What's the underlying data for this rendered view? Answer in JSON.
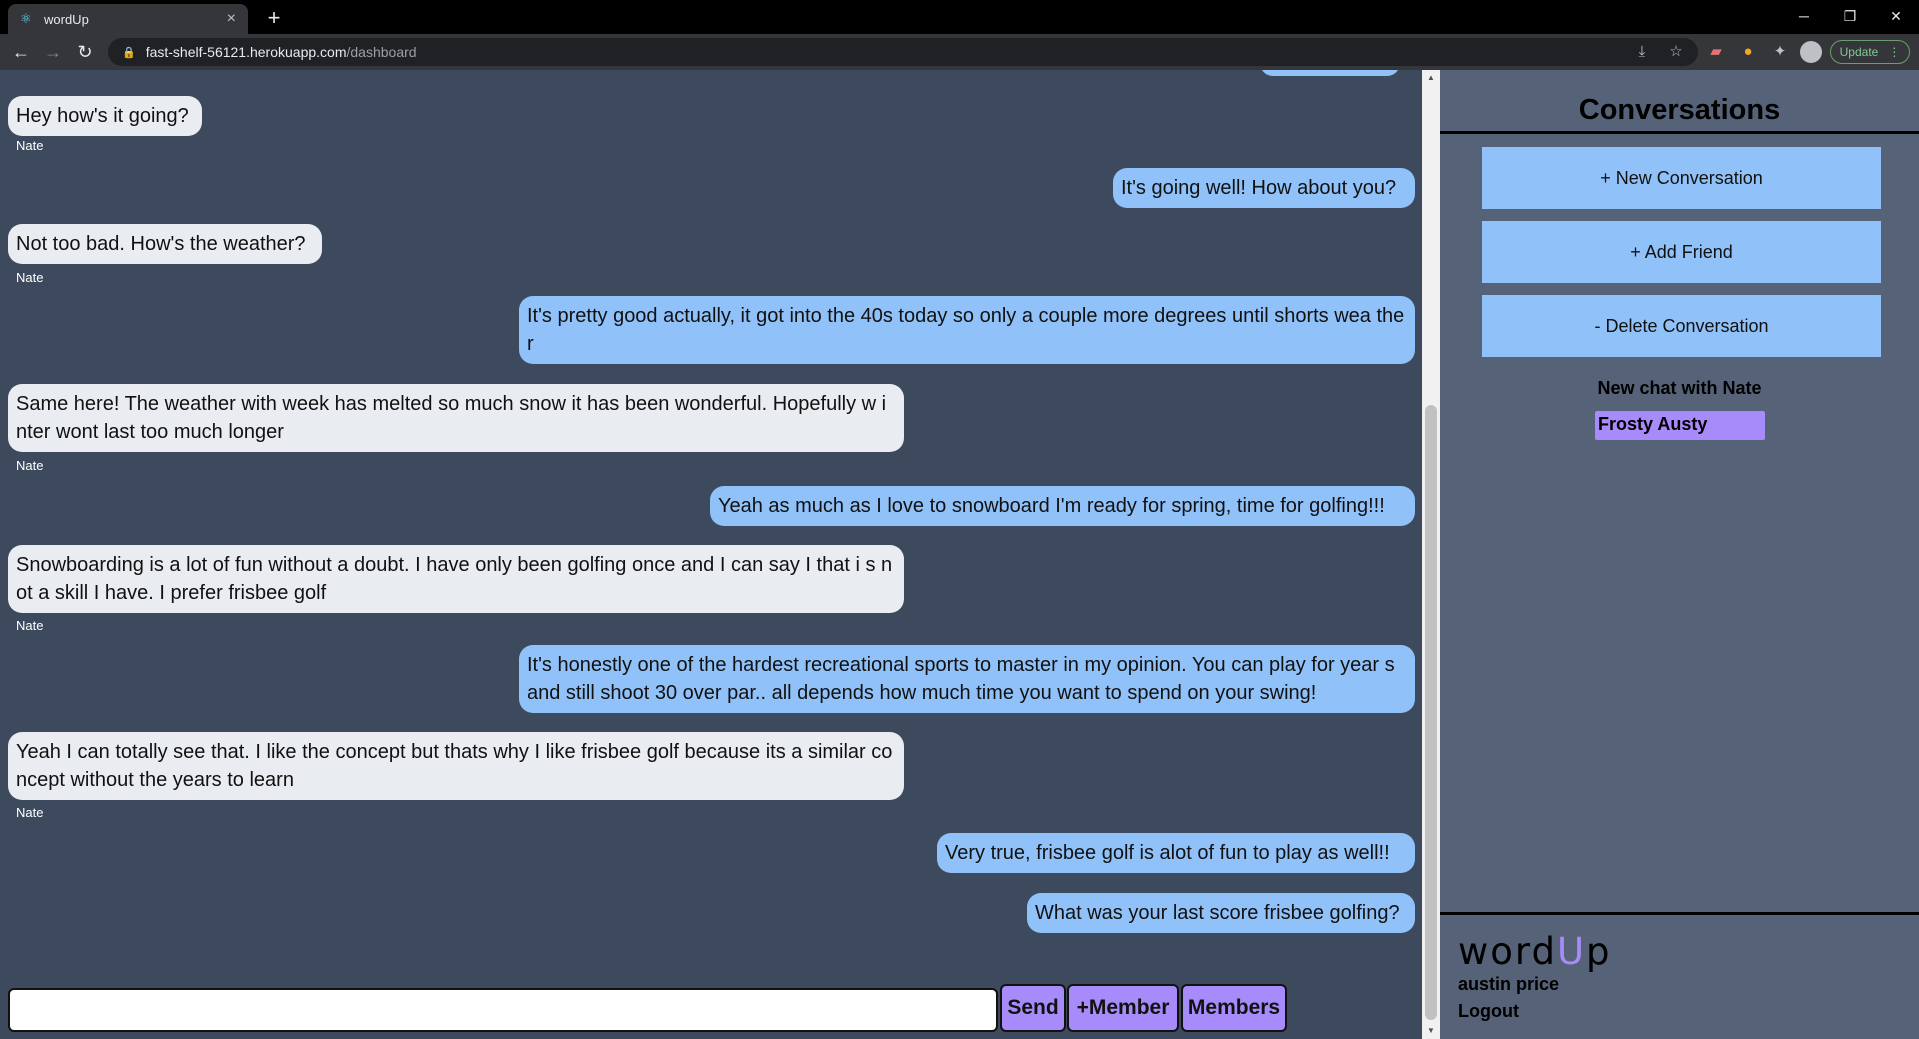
{
  "browser": {
    "tab_title": "wordUp",
    "url_host": "fast-shelf-56121.herokuapp.com",
    "url_path": "/dashboard",
    "update_label": "Update"
  },
  "messages": [
    {
      "dir": "in",
      "text": "Hey how's it going?",
      "sender": "Nate"
    },
    {
      "dir": "out",
      "text": "It's going well! How about you?"
    },
    {
      "dir": "in",
      "text": "Not too bad. How's the weather?",
      "sender": "Nate"
    },
    {
      "dir": "out",
      "text": "It's pretty good actually, it got into the 40s today so only a couple more degrees until shorts wea ther"
    },
    {
      "dir": "in",
      "text": "Same here! The weather with week has melted so much snow it has been wonderful. Hopefully w inter wont last too much longer",
      "sender": "Nate"
    },
    {
      "dir": "out",
      "text": "Yeah as much as I love to snowboard I'm ready for spring, time for golfing!!!"
    },
    {
      "dir": "in",
      "text": "Snowboarding is a lot of fun without a doubt. I have only been golfing once and I can say I that i s not a skill I have. I prefer frisbee golf",
      "sender": "Nate"
    },
    {
      "dir": "out",
      "text": "It's honestly one of the hardest recreational sports to master in my opinion. You can play for year s and still shoot 30 over par.. all depends how much time you want to spend on your swing!"
    },
    {
      "dir": "in",
      "text": "Yeah I can totally see that. I like the concept but thats why I like frisbee golf because its a similar concept without the years to learn",
      "sender": "Nate"
    },
    {
      "dir": "out",
      "text": "Very true, frisbee golf is alot of fun to play as well!!"
    },
    {
      "dir": "out",
      "text": "What was your last score frisbee golfing?"
    }
  ],
  "composer": {
    "value": "",
    "send_label": "Send",
    "add_member_label": "+Member",
    "members_label": "Members"
  },
  "sidebar": {
    "title": "Conversations",
    "new_conversation_label": "+ New Conversation",
    "add_friend_label": "+ Add Friend",
    "delete_conversation_label": "- Delete Conversation",
    "chat_heading": "New chat with Nate",
    "chat_item": "Frosty Austy",
    "brand_word": "word",
    "brand_u": "U",
    "brand_p": "p",
    "user_name": "austin price",
    "logout_label": "Logout"
  },
  "colors": {
    "background": "#3d4a5e",
    "sidebar": "#556277",
    "incoming_bubble": "#e9ecf0",
    "outgoing_bubble": "#90c2f9",
    "accent": "#a78bfa"
  }
}
